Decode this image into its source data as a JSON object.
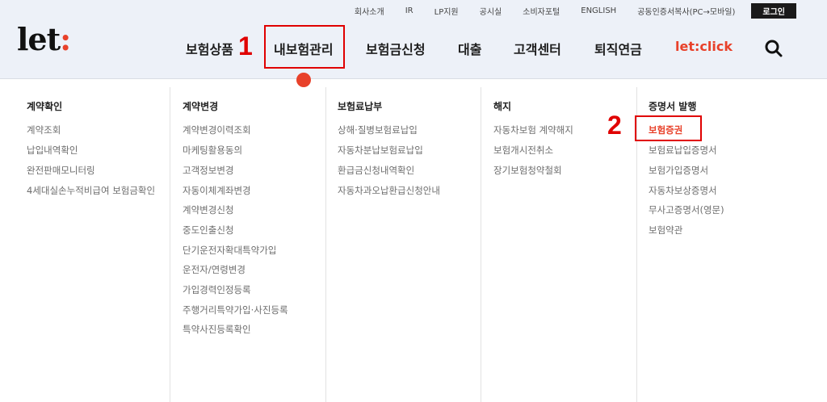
{
  "util_links": [
    "회사소개",
    "IR",
    "LP지원",
    "공시실",
    "소비자포털",
    "ENGLISH",
    "공동인증서복사(PC→모바일)"
  ],
  "login_label": "로그인",
  "logo": {
    "text": "let",
    "colon": ":"
  },
  "gnb": [
    "보험상품",
    "내보험관리",
    "보험금신청",
    "대출",
    "고객센터",
    "퇴직연금",
    "let:click"
  ],
  "annotations": [
    "1",
    "2"
  ],
  "columns": [
    {
      "title": "계약확인",
      "items": [
        "계약조회",
        "납입내역확인",
        "완전판매모니터링",
        "4세대실손누적비급여 보험금확인"
      ]
    },
    {
      "title": "계약변경",
      "items": [
        "계약변경이력조회",
        "마케팅활용동의",
        "고객정보변경",
        "자동이체계좌변경",
        "계약변경신청",
        "중도인출신청",
        "단기운전자확대특약가입",
        "운전자/연령변경",
        "가입경력인정등록",
        "주행거리특약가입·사진등록",
        "특약사진등록확인"
      ]
    },
    {
      "title": "보험료납부",
      "items": [
        "상해·질병보험료납입",
        "자동차분납보험료납입",
        "환급금신청내역확인",
        "자동차과오납환급신청안내"
      ]
    },
    {
      "title": "해지",
      "items": [
        "자동차보험 계약해지",
        "보험개시전취소",
        "장기보험청약철회"
      ]
    },
    {
      "title": "증명서 발행",
      "items": [
        "보험증권",
        "보험료납입증명서",
        "보험가입증명서",
        "자동차보상증명서",
        "무사고증명서(영문)",
        "보험약관"
      ]
    }
  ],
  "colors": {
    "accent": "#e8412a",
    "annotation": "#e00000",
    "header_bg": "#edf1f8"
  }
}
